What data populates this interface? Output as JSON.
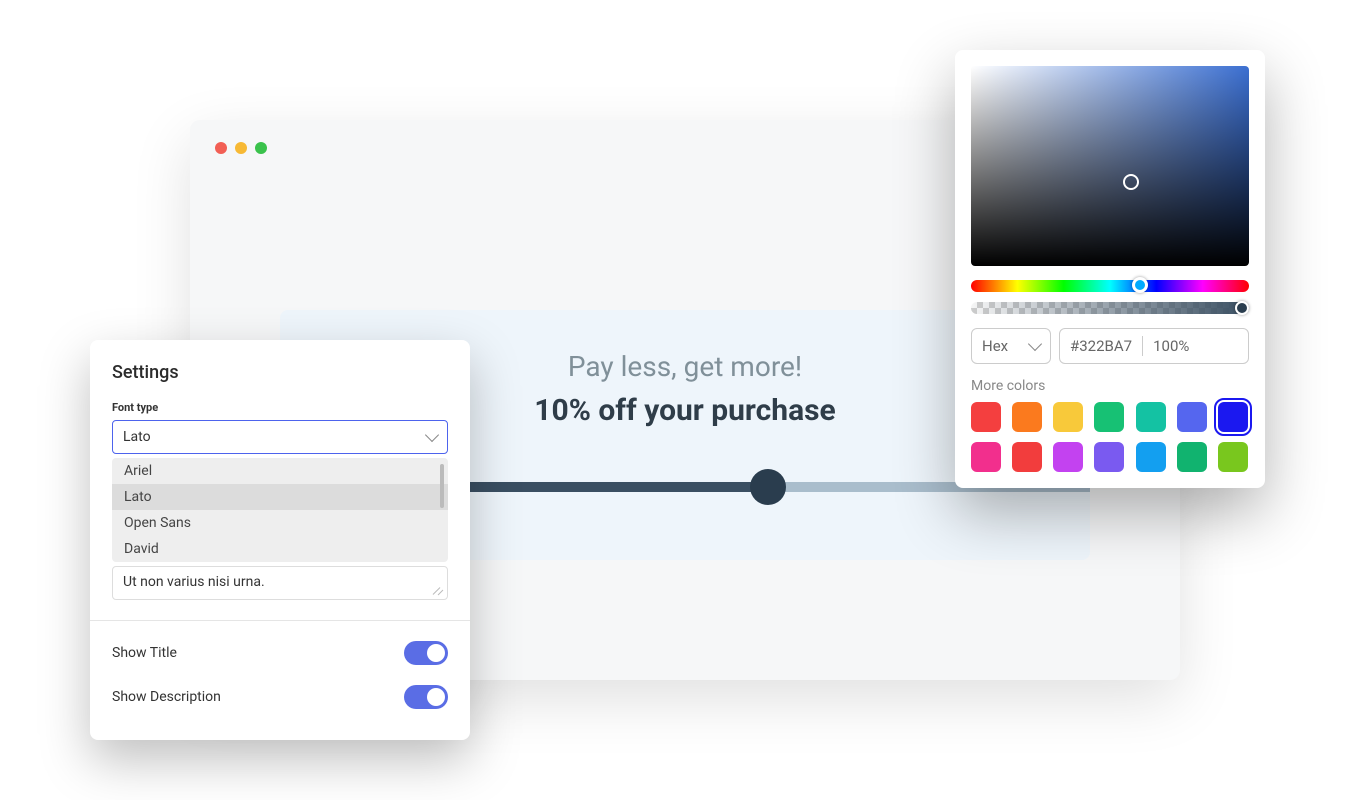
{
  "preview": {
    "title": "Pay less, get more!",
    "subtitle": "10% off your purchase"
  },
  "settings": {
    "heading": "Settings",
    "font_type_label": "Font type",
    "font_selected": "Lato",
    "font_options": [
      "Ariel",
      "Lato",
      "Open Sans",
      "David"
    ],
    "textarea_value": "Ut non varius nisi urna.",
    "toggles": {
      "show_title": {
        "label": "Show Title",
        "on": true
      },
      "show_description": {
        "label": "Show Description",
        "on": true
      }
    }
  },
  "color_picker": {
    "format": "Hex",
    "hex_value": "#322BA7",
    "opacity": "100%",
    "more_label": "More colors",
    "swatches": [
      "#f43f3f",
      "#fb7a1e",
      "#f8c93a",
      "#17c174",
      "#14c2a3",
      "#5566ef",
      "#1b18f0",
      "#f22f8d",
      "#f23d3d",
      "#c342f0",
      "#7a5af0",
      "#139ff0",
      "#11b36f",
      "#79c71e"
    ],
    "selected_swatch_index": 6
  }
}
